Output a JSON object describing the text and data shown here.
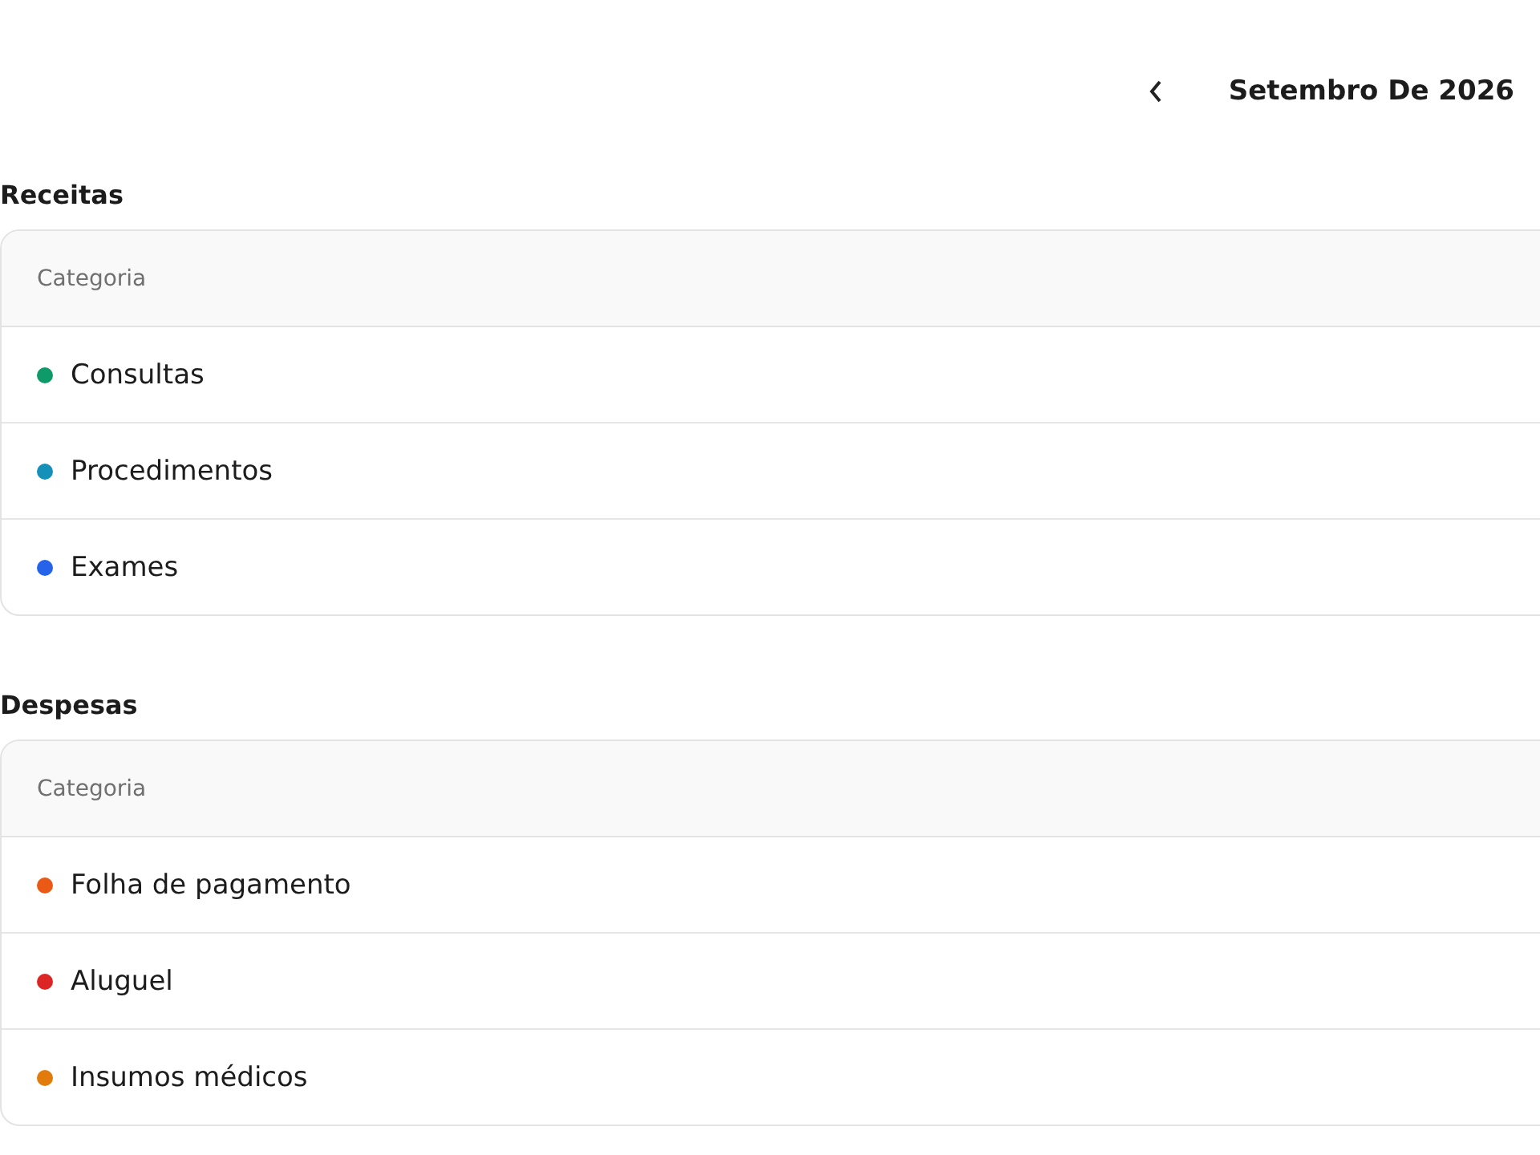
{
  "header": {
    "month_title": "Setembro De 2026"
  },
  "sections": [
    {
      "title": "Receitas",
      "column": "Categoria",
      "rows": [
        {
          "label": "Consultas",
          "color": "#0f9a6a"
        },
        {
          "label": "Procedimentos",
          "color": "#1590b8"
        },
        {
          "label": "Exames",
          "color": "#2563eb"
        }
      ]
    },
    {
      "title": "Despesas",
      "column": "Categoria",
      "rows": [
        {
          "label": "Folha de pagamento",
          "color": "#ea5a16"
        },
        {
          "label": "Aluguel",
          "color": "#dc2626"
        },
        {
          "label": "Insumos médicos",
          "color": "#e07b0c"
        }
      ]
    }
  ]
}
